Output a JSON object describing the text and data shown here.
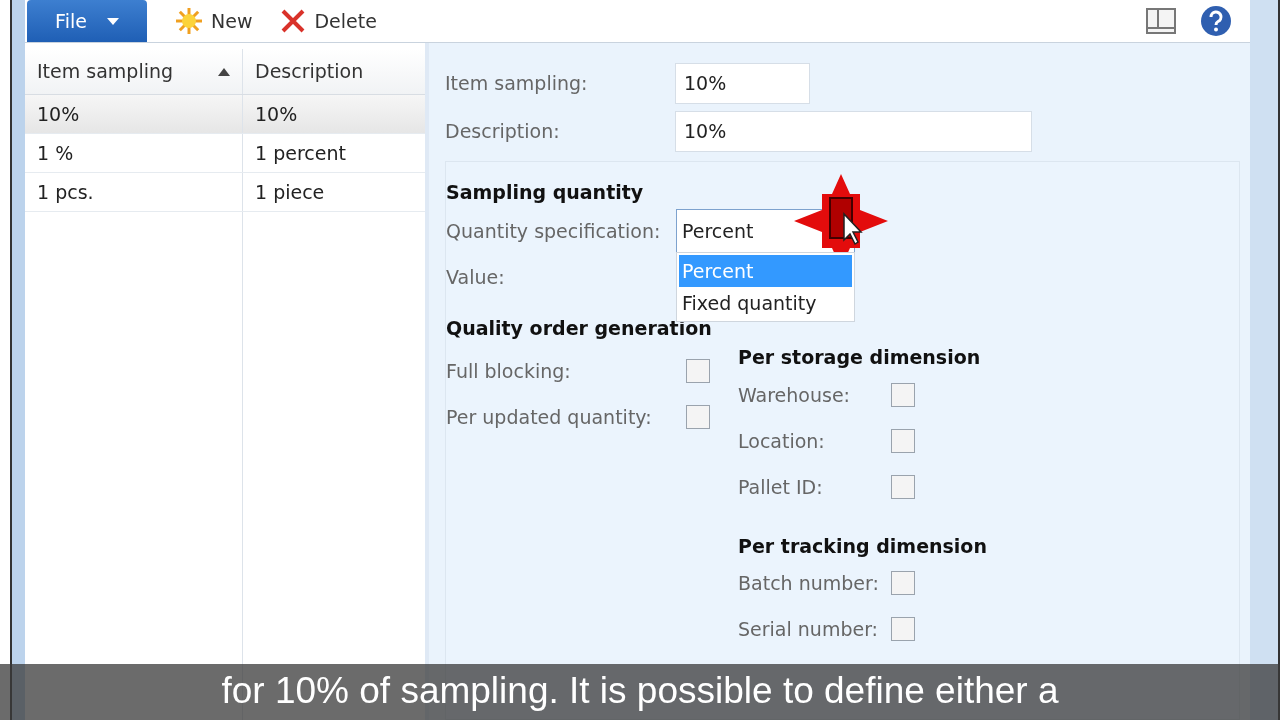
{
  "toolbar": {
    "file_button": "File",
    "buttons": [
      {
        "kind": "new",
        "label": "New"
      },
      {
        "kind": "delete",
        "label": "Delete"
      }
    ]
  },
  "list": {
    "columns": [
      {
        "label": "Item sampling",
        "sorted": true
      },
      {
        "label": "Description",
        "sorted": false
      }
    ],
    "rows": [
      {
        "cells": [
          "10%",
          "10%"
        ],
        "selected": true
      },
      {
        "cells": [
          "1 %",
          "1 percent"
        ],
        "selected": false
      },
      {
        "cells": [
          "1 pcs.",
          "1 piece"
        ],
        "selected": false
      }
    ]
  },
  "form": {
    "fields": [
      {
        "label": "Item sampling:",
        "value": "10%",
        "kind": "short"
      },
      {
        "label": "Description:",
        "value": "10%",
        "kind": "long"
      }
    ],
    "sampling_quantity": {
      "title": "Sampling quantity",
      "quantity_specification": {
        "label": "Quantity specification:",
        "value": "Percent",
        "expanded": true,
        "options": [
          {
            "label": "Percent",
            "selected": true
          },
          {
            "label": "Fixed quantity",
            "selected": false
          }
        ]
      },
      "value_label": "Value:"
    },
    "quality_order_generation": {
      "title": "Quality order generation",
      "checks": [
        {
          "label": "Full blocking:",
          "checked": false
        },
        {
          "label": "Per updated quantity:",
          "checked": false
        }
      ],
      "per_storage_dimension": {
        "title": "Per storage dimension",
        "checks": [
          {
            "label": "Warehouse:",
            "checked": false
          },
          {
            "label": "Location:",
            "checked": false
          },
          {
            "label": "Pallet ID:",
            "checked": false
          }
        ]
      },
      "per_tracking_dimension": {
        "title": "Per tracking dimension",
        "checks": [
          {
            "label": "Batch number:",
            "checked": false
          },
          {
            "label": "Serial number:",
            "checked": false
          }
        ]
      }
    }
  },
  "subtitle": "for 10% of sampling. It is possible to define either a"
}
